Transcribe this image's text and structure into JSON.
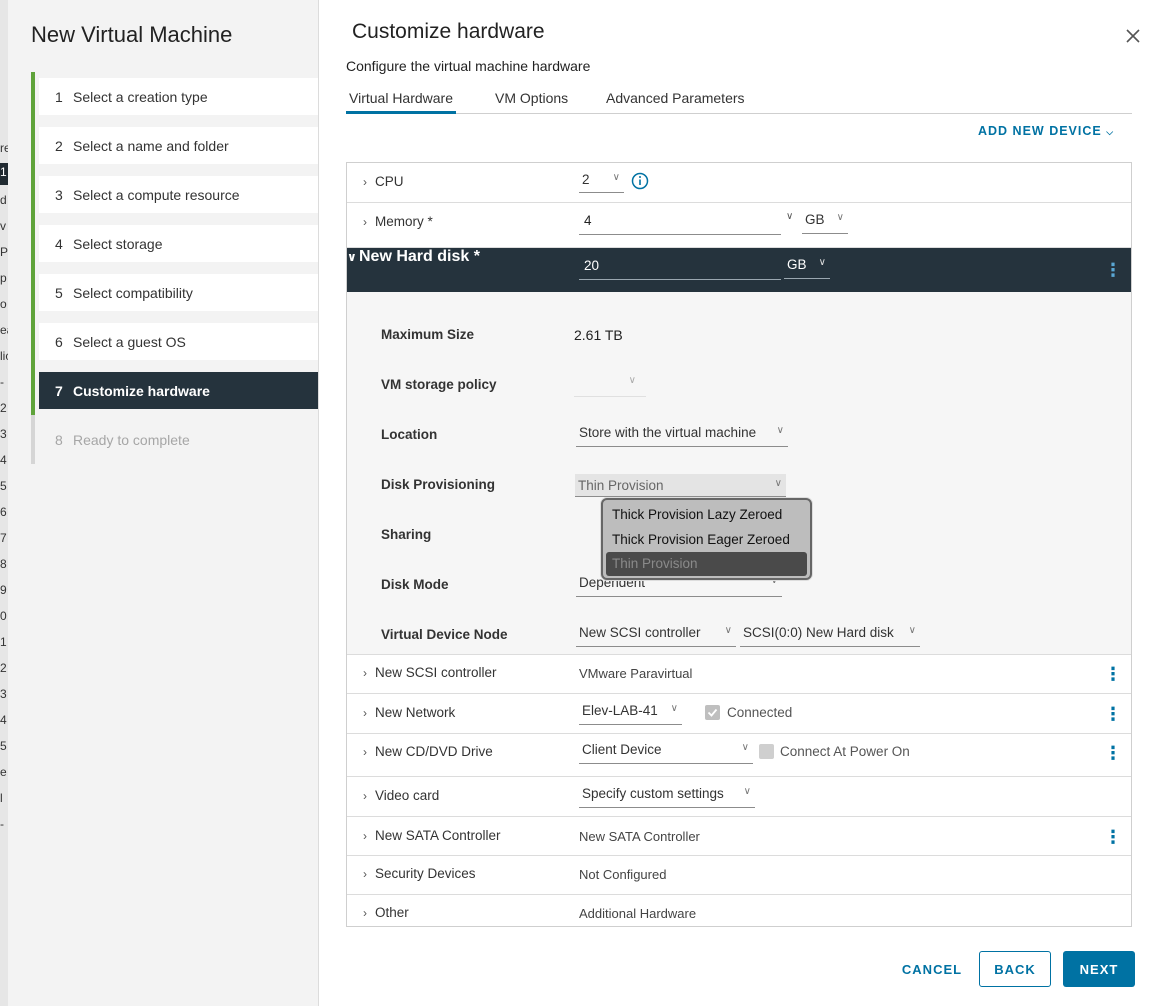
{
  "backdrop": {
    "fragments": [
      "re",
      "1",
      "d",
      "v",
      "P",
      "p",
      "o",
      "ea",
      "lic",
      "-",
      "2",
      "3",
      "4",
      "5",
      "6",
      "7",
      "8",
      "9",
      "0",
      "1",
      "2",
      "3",
      "4",
      "5",
      "e",
      "l",
      "-"
    ]
  },
  "wizard": {
    "title": "New Virtual Machine",
    "steps": [
      {
        "num": "1",
        "label": "Select a creation type"
      },
      {
        "num": "2",
        "label": "Select a name and folder"
      },
      {
        "num": "3",
        "label": "Select a compute resource"
      },
      {
        "num": "4",
        "label": "Select storage"
      },
      {
        "num": "5",
        "label": "Select compatibility"
      },
      {
        "num": "6",
        "label": "Select a guest OS"
      },
      {
        "num": "7",
        "label": "Customize hardware"
      },
      {
        "num": "8",
        "label": "Ready to complete"
      }
    ]
  },
  "page": {
    "title": "Customize hardware",
    "subtitle": "Configure the virtual machine hardware",
    "tabs": [
      "Virtual Hardware",
      "VM Options",
      "Advanced Parameters"
    ],
    "add_device": "ADD NEW DEVICE"
  },
  "hardware": {
    "cpu": {
      "label": "CPU",
      "value": "2"
    },
    "memory": {
      "label": "Memory *",
      "value": "4",
      "unit": "GB"
    },
    "hard_disk": {
      "label": "New Hard disk *",
      "value": "20",
      "unit": "GB"
    },
    "details": {
      "max_size_label": "Maximum Size",
      "max_size_value": "2.61 TB",
      "storage_policy_label": "VM storage policy",
      "location_label": "Location",
      "location_value": "Store with the virtual machine",
      "provisioning_label": "Disk Provisioning",
      "provisioning_value": "Thin Provision",
      "sharing_label": "Sharing",
      "disk_mode_label": "Disk Mode",
      "disk_mode_value": "Dependent",
      "vdn_label": "Virtual Device Node",
      "vdn_controller": "New SCSI controller",
      "vdn_node": "SCSI(0:0) New Hard disk"
    },
    "provisioning_options": [
      "Thick Provision Lazy Zeroed",
      "Thick Provision Eager Zeroed",
      "Thin Provision"
    ],
    "scsi": {
      "label": "New SCSI controller",
      "value": "VMware Paravirtual"
    },
    "network": {
      "label": "New Network",
      "value": "Elev-LAB-41",
      "connected_label": "Connected"
    },
    "cddvd": {
      "label": "New CD/DVD Drive",
      "value": "Client Device",
      "connect_label": "Connect At Power On"
    },
    "video": {
      "label": "Video card",
      "value": "Specify custom settings"
    },
    "sata": {
      "label": "New SATA Controller",
      "value": "New SATA Controller"
    },
    "security": {
      "label": "Security Devices",
      "value": "Not Configured"
    },
    "other": {
      "label": "Other",
      "value": "Additional Hardware"
    }
  },
  "footer": {
    "cancel": "CANCEL",
    "back": "BACK",
    "next": "NEXT"
  },
  "colors": {
    "accent": "#0072a3",
    "dark_header": "#25333d",
    "progress_green": "#5fa33a"
  }
}
